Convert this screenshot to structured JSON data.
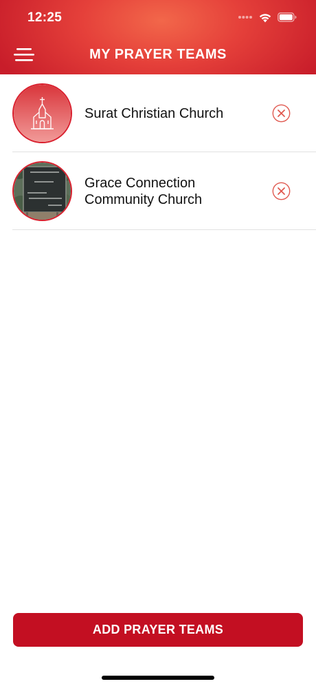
{
  "status_bar": {
    "time": "12:25",
    "icons": [
      "signal-dots-icon",
      "wifi-icon",
      "battery-icon"
    ]
  },
  "header": {
    "title": "MY PRAYER TEAMS",
    "menu_icon": "hamburger-menu-icon"
  },
  "teams": [
    {
      "name": "Surat Christian Church",
      "avatar": "church-icon",
      "remove_icon": "close-circle-icon"
    },
    {
      "name": "Grace Connection Community Church",
      "avatar": "church-sign-photo",
      "remove_icon": "close-circle-icon"
    }
  ],
  "actions": {
    "add_label": "ADD PRAYER TEAMS"
  },
  "colors": {
    "header_gradient": [
      "#f2674a",
      "#e5403a",
      "#c81d2a"
    ],
    "accent_red": "#d9202e",
    "button_red": "#c30f22",
    "divider": "#e1e1e1"
  }
}
